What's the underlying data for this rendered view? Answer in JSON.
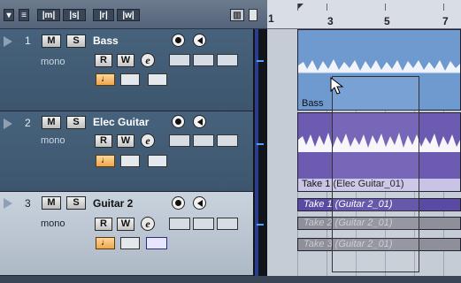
{
  "header": {
    "buttons": [
      {
        "label": "▾",
        "name": "header-collapse-button"
      },
      {
        "label": "≡",
        "name": "header-menu-button"
      },
      {
        "label": "|m|",
        "name": "global-mute-button"
      },
      {
        "label": "|s|",
        "name": "global-solo-button"
      },
      {
        "label": "|r|",
        "name": "global-read-button"
      },
      {
        "label": "|w|",
        "name": "global-write-button"
      }
    ],
    "right_icon": "▥"
  },
  "tracks": [
    {
      "number": "1",
      "name": "Bass",
      "mode": "mono",
      "m": "M",
      "s": "S",
      "r": "R",
      "w": "W",
      "e": "e"
    },
    {
      "number": "2",
      "name": "Elec Guitar",
      "mode": "mono",
      "m": "M",
      "s": "S",
      "r": "R",
      "w": "W",
      "e": "e"
    },
    {
      "number": "3",
      "name": "Guitar 2",
      "mode": "mono",
      "m": "M",
      "s": "S",
      "r": "R",
      "w": "W",
      "e": "e"
    }
  ],
  "ruler": {
    "start": "1",
    "marks": [
      "3",
      "5",
      "7"
    ]
  },
  "events": {
    "bass": "Bass",
    "elec": "Take 1 (Elec Guitar_01)",
    "lanes": [
      "Take 1 (Guitar 2_01)",
      "Take 2 (Guitar 2_01)",
      "Take 3 (Guitar 2_01)"
    ]
  },
  "colors": {
    "track_bg": "#47627c",
    "selected_track_bg": "#c9d3de",
    "bass_event": "#6f9ad0",
    "guitar_event": "#6d5bb2",
    "lane_active": "#5a4aa4",
    "lane_inactive": "#8f8f9a"
  }
}
